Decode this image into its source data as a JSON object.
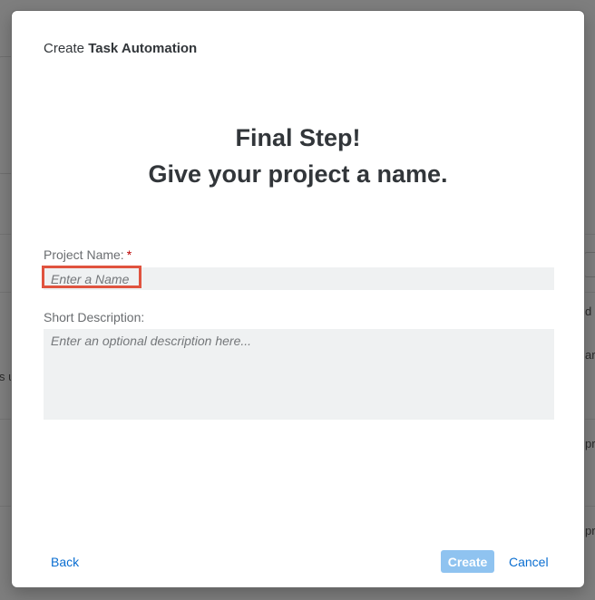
{
  "background": {
    "fragments": [
      "s u",
      "d",
      "ar",
      "pr",
      "pr"
    ]
  },
  "dialog": {
    "title_prefix": "Create",
    "title_strong": "Task Automation",
    "heading_line1": "Final Step!",
    "heading_line2": "Give your project a name."
  },
  "form": {
    "name_label": "Project Name:",
    "name_required_marker": "*",
    "name_value": "",
    "name_placeholder": "Enter a Name",
    "description_label": "Short Description:",
    "description_value": "",
    "description_placeholder": "Enter an optional description here..."
  },
  "footer": {
    "back_label": "Back",
    "create_label": "Create",
    "create_enabled": false,
    "cancel_label": "Cancel"
  },
  "colors": {
    "accent": "#0a6ed1",
    "highlight": "#e0533f",
    "disabled_button": "#8fc3f0",
    "required": "#bb0000"
  }
}
